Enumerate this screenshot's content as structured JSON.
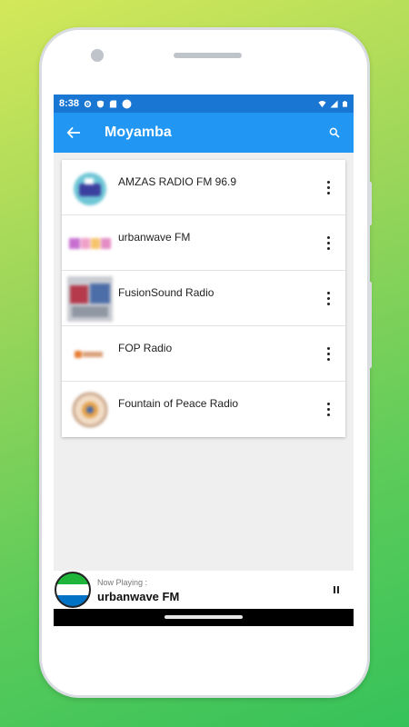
{
  "status_bar": {
    "time": "8:38",
    "left_icons": [
      "gear-icon",
      "shield-icon",
      "sd-card-icon",
      "circle-icon"
    ],
    "right_icons": [
      "wifi-icon",
      "signal-icon",
      "battery-icon"
    ]
  },
  "app_bar": {
    "title": "Moyamba",
    "back_icon": "arrow-left-icon",
    "search_icon": "search-icon",
    "color": "#2196f3",
    "status_color": "#1976d2"
  },
  "stations": [
    {
      "name": "AMZAS RADIO FM 96.9",
      "logo": "amzas-logo"
    },
    {
      "name": "urbanwave FM",
      "logo": "urbanwave-logo"
    },
    {
      "name": "FusionSound Radio",
      "logo": "fusionsound-logo"
    },
    {
      "name": "FOP Radio",
      "logo": "fop-logo"
    },
    {
      "name": "Fountain of Peace Radio",
      "logo": "fountain-logo"
    }
  ],
  "player": {
    "label": "Now Playing :",
    "station": "urbanwave FM",
    "pause_icon": "pause-icon",
    "flag_colors": [
      "#1eb53a",
      "#ffffff",
      "#0072c6"
    ]
  }
}
